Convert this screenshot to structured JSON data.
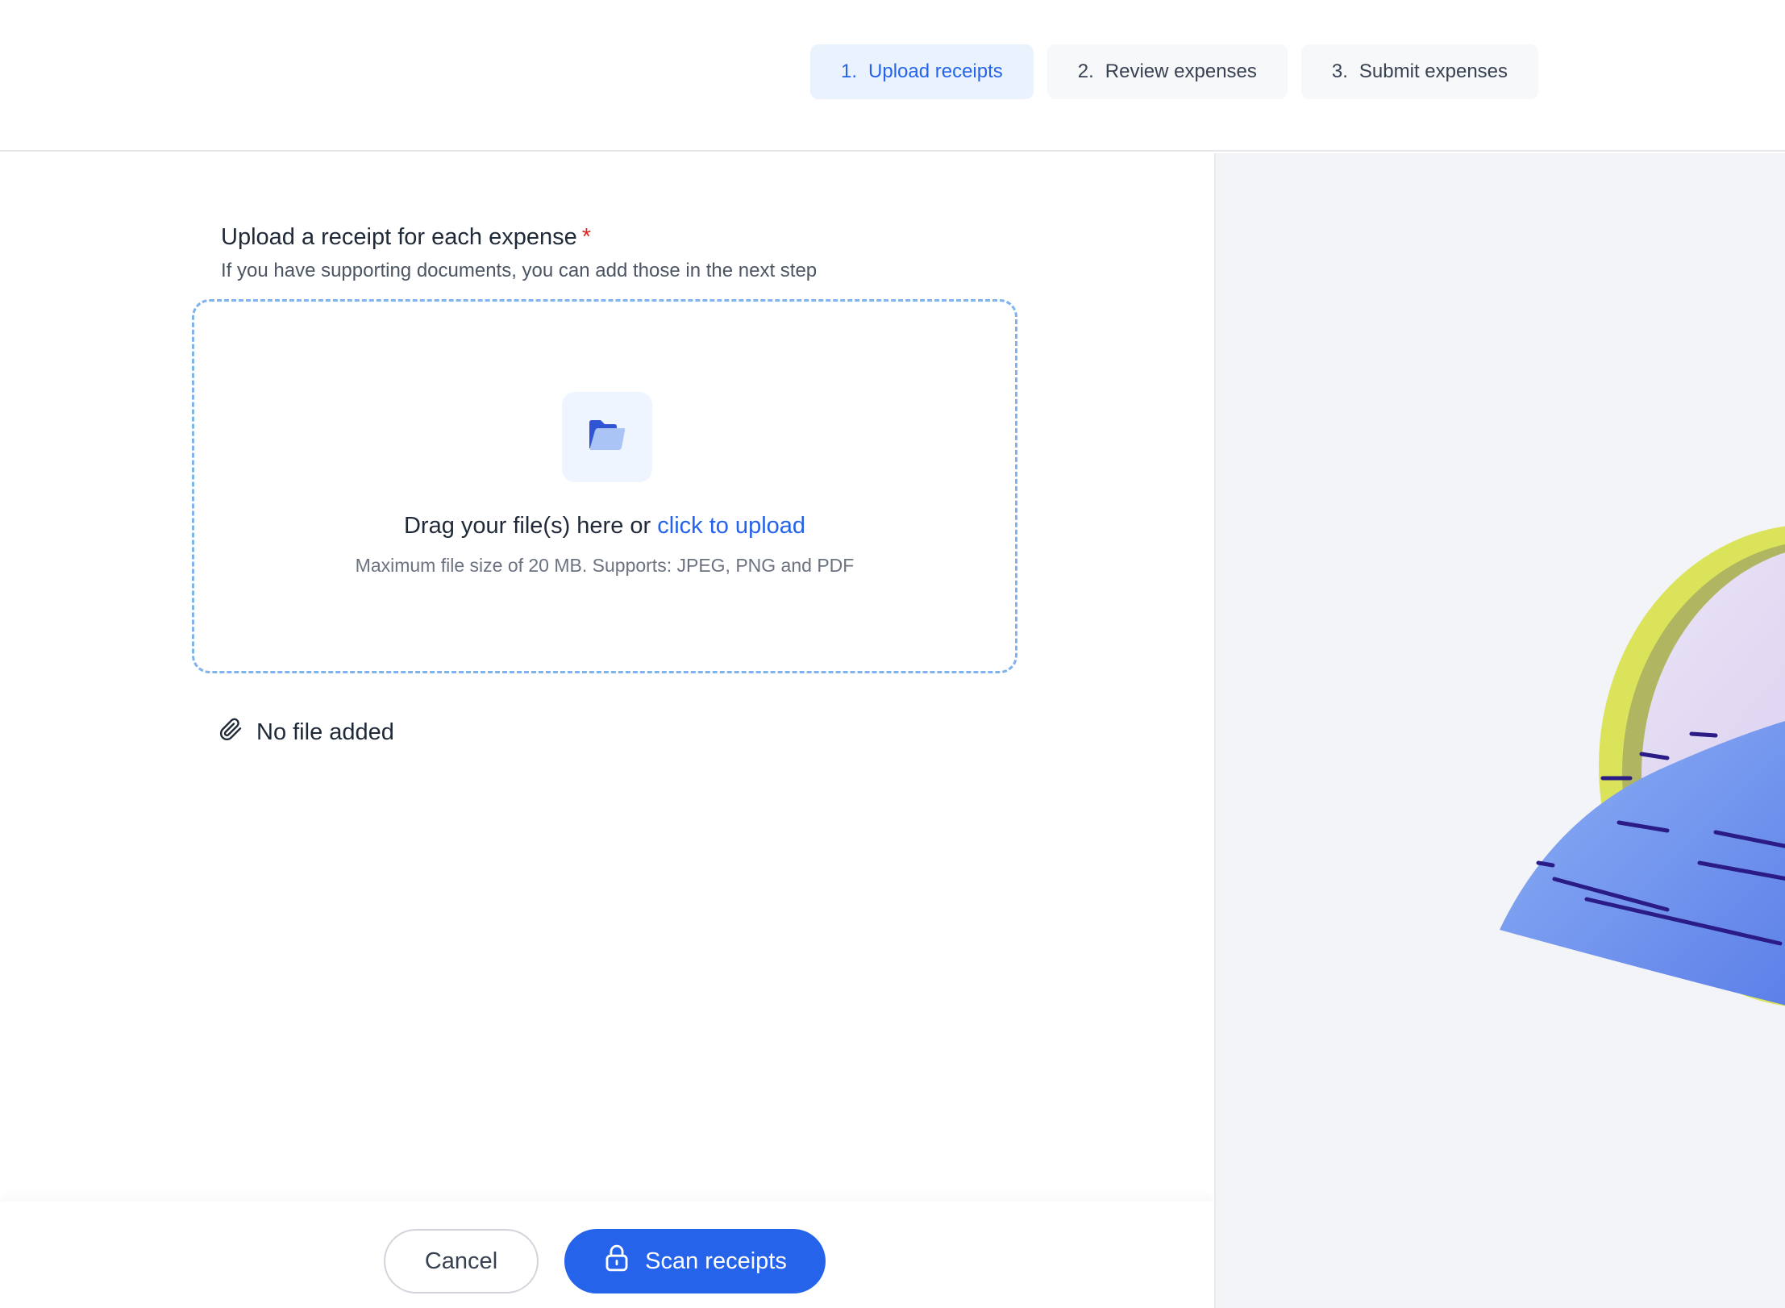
{
  "stepper": {
    "steps": [
      {
        "num": "1.",
        "label": "Upload receipts",
        "active": true
      },
      {
        "num": "2.",
        "label": "Review expenses",
        "active": false
      },
      {
        "num": "3.",
        "label": "Submit expenses",
        "active": false
      }
    ]
  },
  "upload": {
    "title": "Upload a receipt for each expense",
    "required_mark": "*",
    "subtitle": "If you have supporting documents, you can add those in the next step",
    "drop_text": "Drag your file(s) here or",
    "drop_link": "click to upload",
    "hint": "Maximum file size of 20 MB. Supports: JPEG, PNG and PDF",
    "folder_icon": "folder-icon"
  },
  "file_status": {
    "icon": "paperclip-icon",
    "text": "No file added"
  },
  "footer": {
    "cancel_label": "Cancel",
    "scan_label": "Scan receipts",
    "scan_icon": "lock-icon"
  },
  "colors": {
    "accent": "#2563eb",
    "required": "#dc2626",
    "dropzone_border": "#7eb3ee",
    "active_step_bg": "#eaf3fd",
    "side_bg": "#f3f4f7"
  }
}
